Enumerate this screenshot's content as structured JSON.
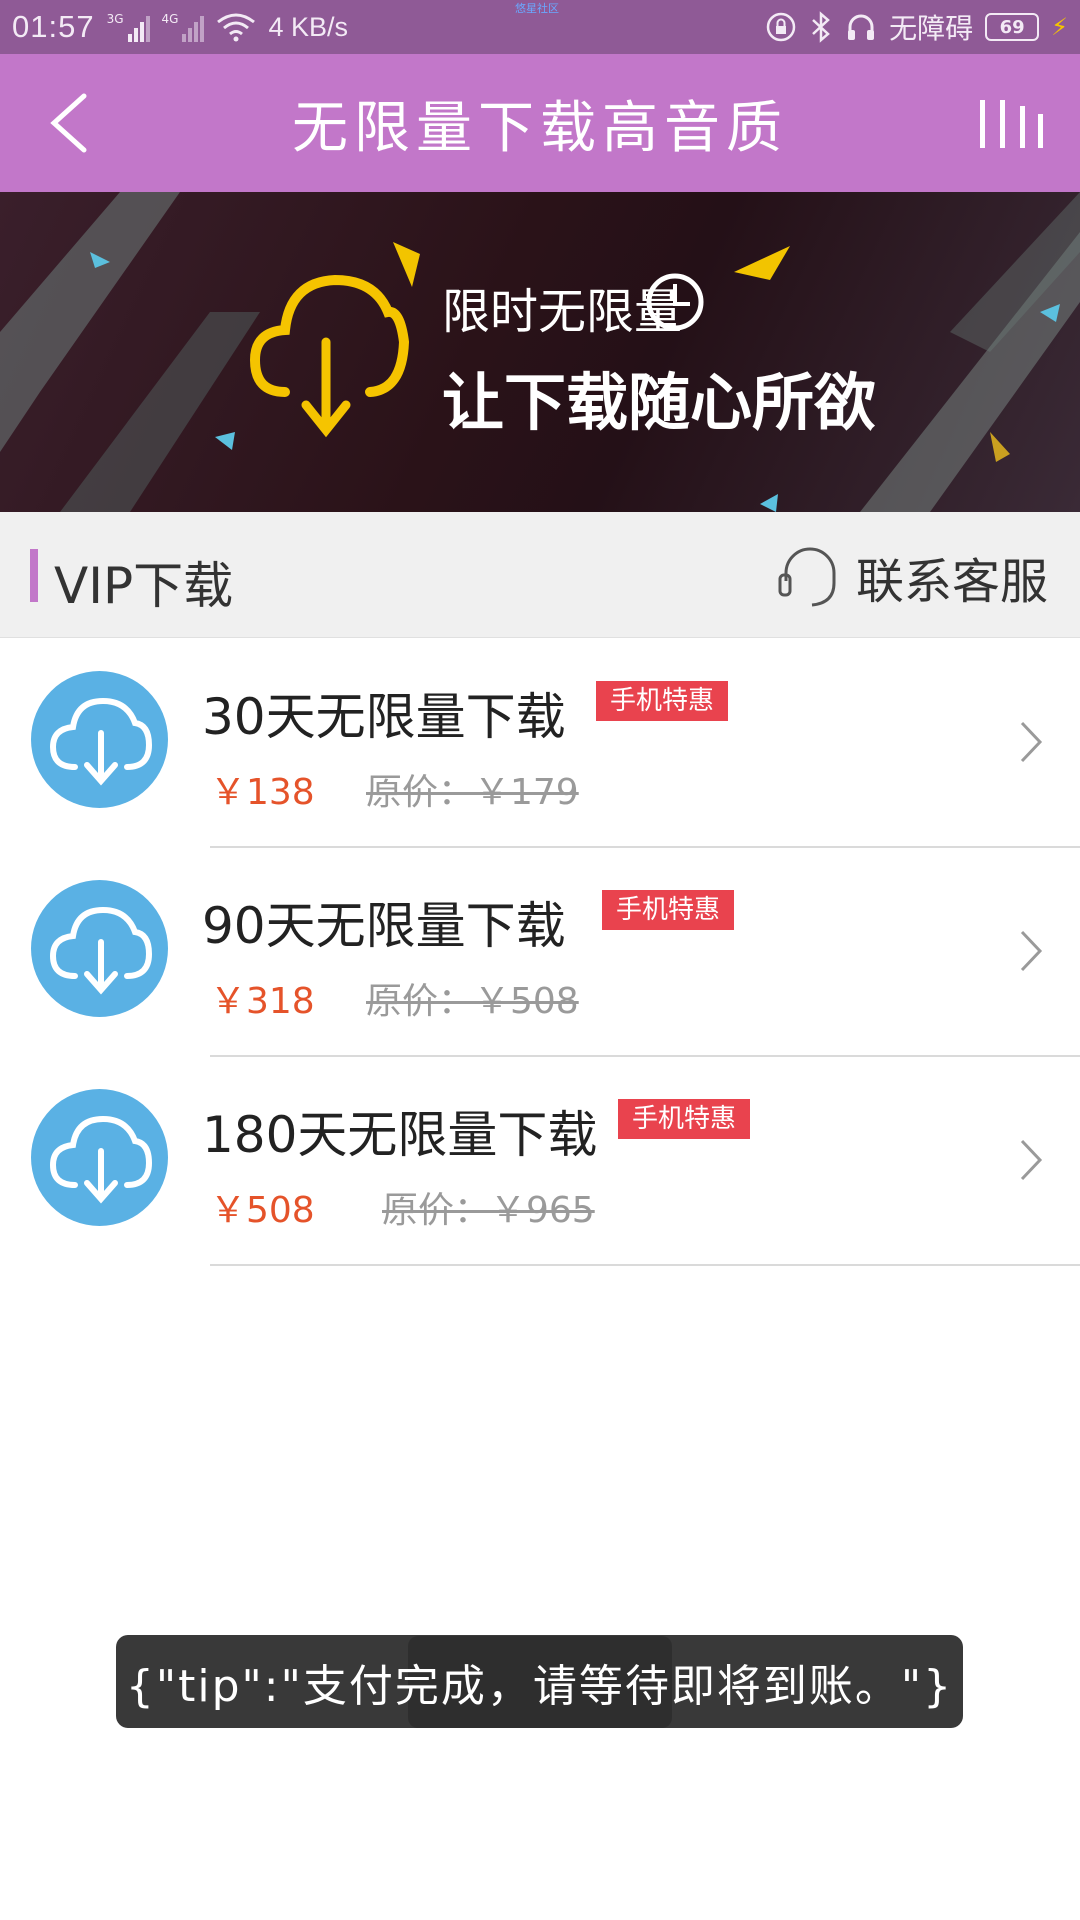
{
  "status_bar": {
    "time": "01:57",
    "net1": "3G",
    "net2": "4G",
    "speed": "4 KB/s",
    "center_tag": "悠星社区",
    "mode": "无障碍",
    "battery": "69"
  },
  "header": {
    "title": "无限量下载高音质",
    "back_icon": "chevron-left-icon",
    "menu_icon": "bars-icon"
  },
  "banner": {
    "line1": "限时无限量",
    "line2": "让下载随心所欲"
  },
  "section": {
    "title": "VIP下载",
    "support_label": "联系客服"
  },
  "items": [
    {
      "title": "30天无限量下载",
      "badge": "手机特惠",
      "price": "￥138",
      "original": "原价：￥179"
    },
    {
      "title": "90天无限量下载",
      "badge": "手机特惠",
      "price": "￥318",
      "original": "原价：￥508"
    },
    {
      "title": "180天无限量下载",
      "badge": "手机特惠",
      "price": "￥508",
      "original": "原价：￥965"
    }
  ],
  "toast": {
    "text": "{\"tip\":\"支付完成，请等待即将到账。\"}"
  },
  "colors": {
    "header_bg": "#c277c9",
    "status_bg": "#8f5a96",
    "price": "#e5532a",
    "badge": "#e9434e",
    "icon_circle": "#5ab1e4"
  }
}
